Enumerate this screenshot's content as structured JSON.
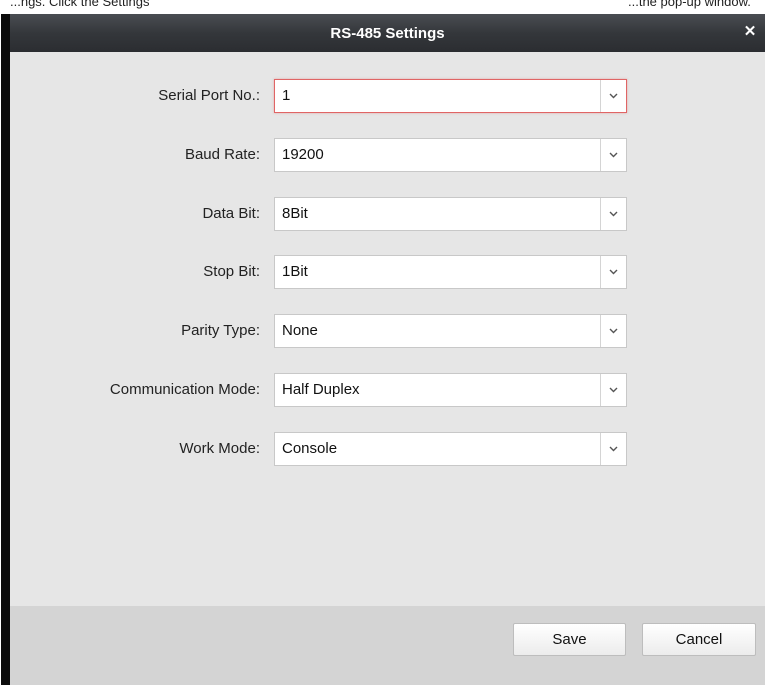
{
  "background_caption": {
    "left_text": "...ngs. Click the Settings",
    "right_text": "...the pop-up window."
  },
  "dialog": {
    "title": "RS-485 Settings",
    "close_icon": "close-icon"
  },
  "form": {
    "fields": [
      {
        "label": "Serial Port No.:",
        "value": "1",
        "focused": true
      },
      {
        "label": "Baud Rate:",
        "value": "19200",
        "focused": false
      },
      {
        "label": "Data Bit:",
        "value": "8Bit",
        "focused": false
      },
      {
        "label": "Stop Bit:",
        "value": "1Bit",
        "focused": false
      },
      {
        "label": "Parity Type:",
        "value": "None",
        "focused": false
      },
      {
        "label": "Communication Mode:",
        "value": "Half Duplex",
        "focused": false
      },
      {
        "label": "Work Mode:",
        "value": "Console",
        "focused": false
      }
    ]
  },
  "footer": {
    "save_label": "Save",
    "cancel_label": "Cancel"
  },
  "colors": {
    "titlebar": "#34373b",
    "body_bg": "#e6e6e6",
    "focus_border": "#e06565"
  }
}
